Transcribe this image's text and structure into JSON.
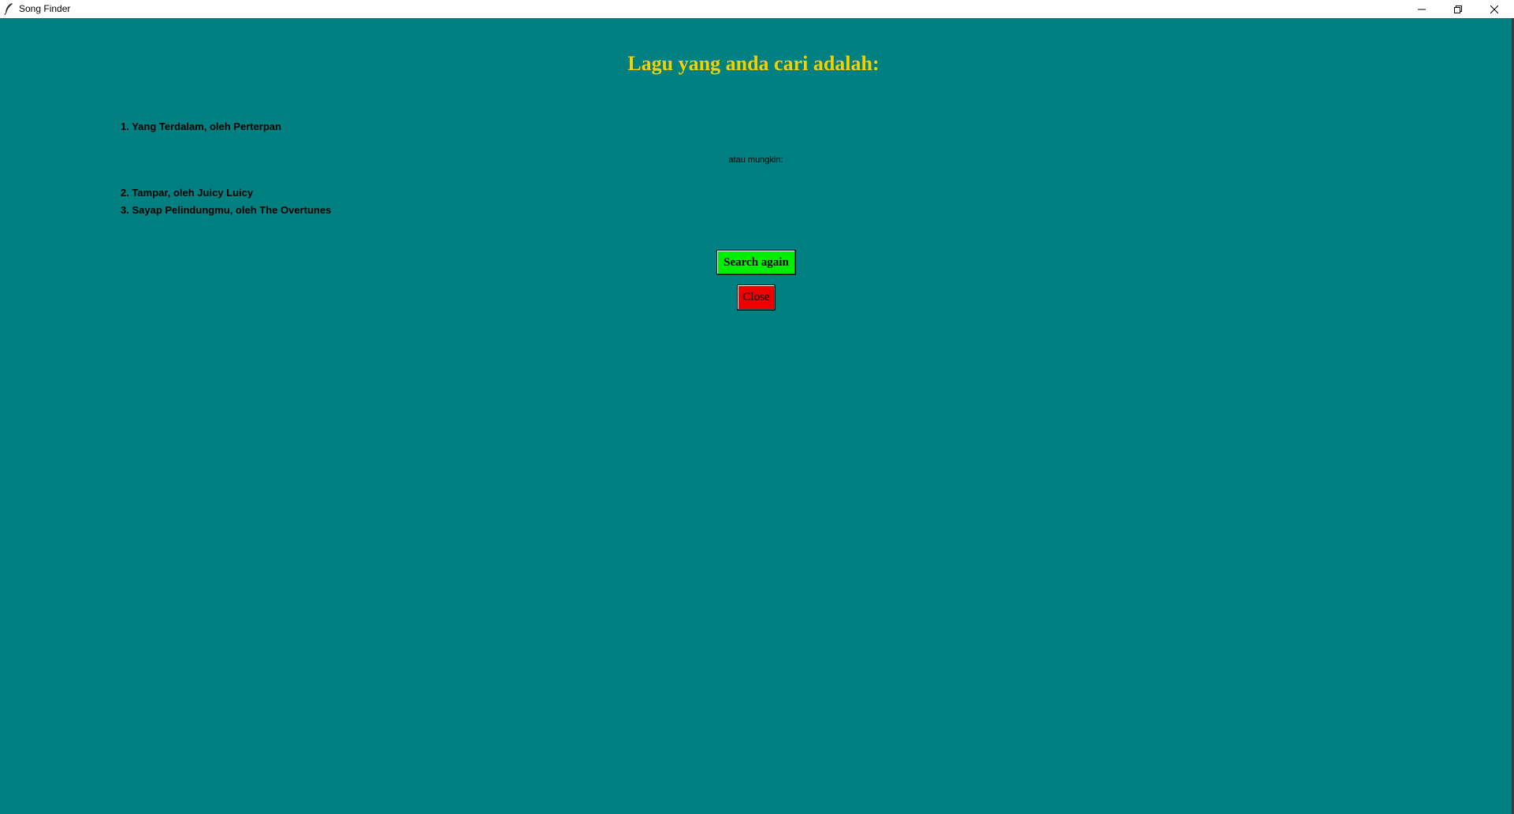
{
  "window": {
    "title": "Song Finder",
    "app_icon": "feather-icon",
    "controls": {
      "minimize_icon": "minimize-icon",
      "restore_icon": "restore-icon",
      "close_icon": "close-icon"
    }
  },
  "colors": {
    "background": "#008080",
    "heading": "#f5d000",
    "search_button": "#00ee00",
    "close_button": "#ee0000"
  },
  "main": {
    "heading": "Lagu yang anda cari adalah:",
    "top_result": "1. Yang Terdalam, oleh Perterpan",
    "alternatives_label": "atau mungkin:",
    "alternatives": [
      "2. Tampar, oleh Juicy Luicy",
      "3. Sayap Pelindungmu, oleh The Overtunes"
    ],
    "search_again_label": "Search again",
    "close_label": "Close"
  }
}
